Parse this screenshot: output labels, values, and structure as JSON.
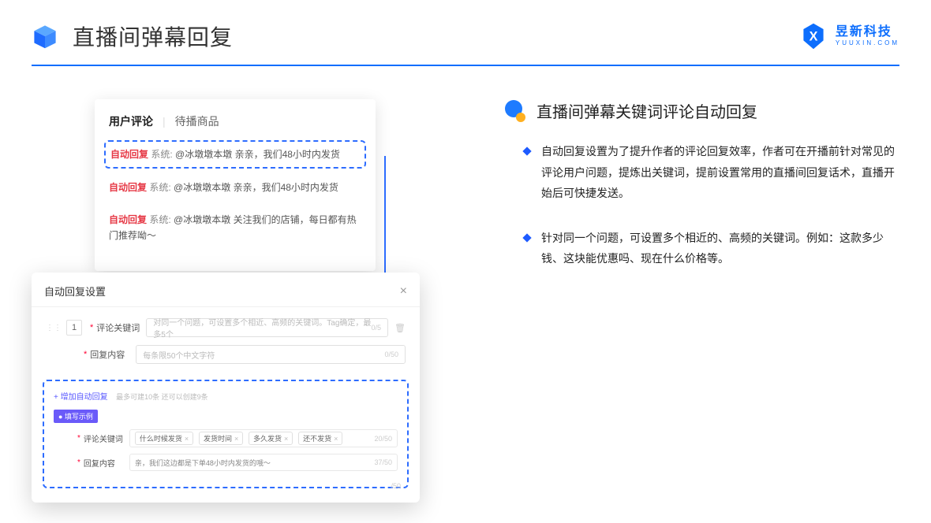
{
  "header": {
    "title": "直播间弹幕回复",
    "brand_cn": "昱新科技",
    "brand_en": "YUUXIN.COM"
  },
  "comments": {
    "tab_active": "用户评论",
    "tab_inactive": "待播商品",
    "items": [
      {
        "badge": "自动回复",
        "sys": "系统:",
        "text": "@冰墩墩本墩 亲亲，我们48小时内发货"
      },
      {
        "badge": "自动回复",
        "sys": "系统:",
        "text": "@冰墩墩本墩 亲亲，我们48小时内发货"
      },
      {
        "badge": "自动回复",
        "sys": "系统:",
        "text": "@冰墩墩本墩 关注我们的店铺，每日都有热门推荐呦～"
      }
    ]
  },
  "modal": {
    "title": "自动回复设置",
    "index": "1",
    "field_keyword_label": "评论关键词",
    "field_keyword_placeholder": "对同一个问题，可设置多个相近、高频的关键词。Tag确定，最多5个",
    "field_keyword_counter": "0/5",
    "field_reply_label": "回复内容",
    "field_reply_placeholder": "每条限50个中文字符",
    "field_reply_counter": "0/50",
    "add_link": "+ 增加自动回复",
    "add_hint": "最多可建10条 还可以创建9条",
    "example_badge": "● 填写示例",
    "example_keyword_label": "评论关键词",
    "example_tags": [
      "什么时候发货",
      "发货时间",
      "多久发货",
      "还不发货"
    ],
    "example_keyword_counter": "20/50",
    "example_reply_label": "回复内容",
    "example_reply_text": "亲，我们这边都是下单48小时内发货的哦～",
    "example_reply_counter": "37/50",
    "ghost_counter": "/50"
  },
  "right": {
    "section_title": "直播间弹幕关键词评论自动回复",
    "bullets": [
      "自动回复设置为了提升作者的评论回复效率，作者可在开播前针对常见的评论用户问题，提炼出关键词，提前设置常用的直播间回复话术，直播开始后可快捷发送。",
      "针对同一个问题，可设置多个相近的、高频的关键词。例如：这款多少钱、这块能优惠吗、现在什么价格等。"
    ]
  }
}
